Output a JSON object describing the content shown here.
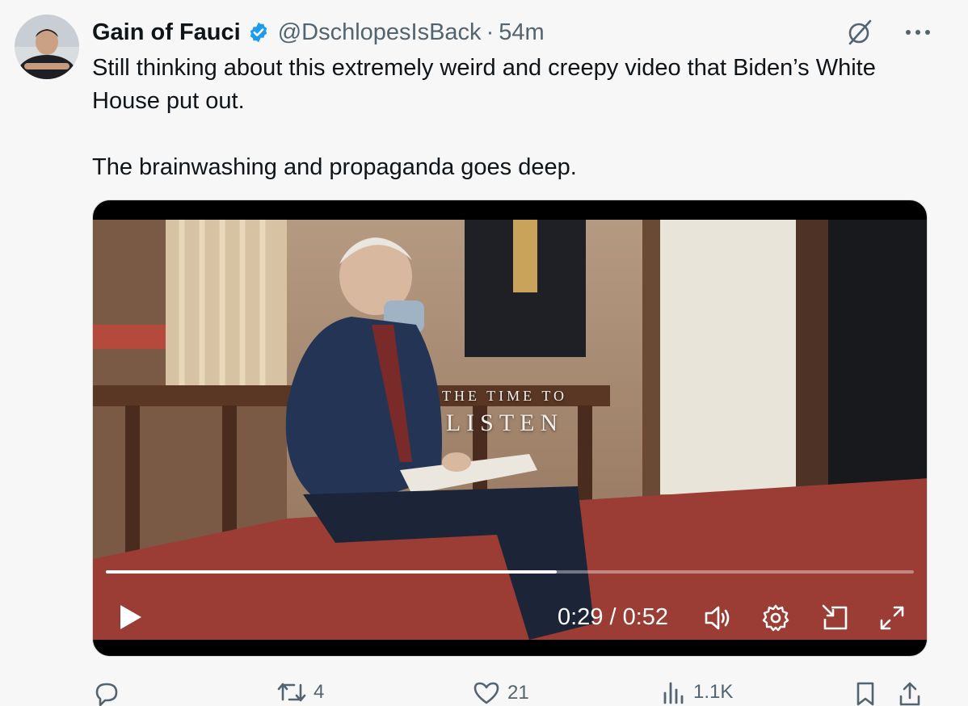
{
  "author": {
    "display_name": "Gain of Fauci",
    "handle": "@DschlopesIsBack",
    "separator": "·",
    "timestamp": "54m",
    "verified": true
  },
  "tweet": {
    "text": "Still thinking about this extremely weird and creepy video that Biden’s White House put out.\n\nThe brainwashing and propaganda goes deep."
  },
  "video": {
    "overlay_line1": "THE TIME TO",
    "overlay_line2": "LISTEN",
    "timecode": "0:29 / 0:52",
    "progress_fraction": 0.558,
    "controls": [
      "play-icon",
      "volume-icon",
      "settings-icon",
      "picture-in-picture-icon",
      "fullscreen-icon"
    ]
  },
  "actions": {
    "reply_count": "",
    "retweet_count": "4",
    "like_count": "21",
    "views_count": "1.1K"
  },
  "colors": {
    "verified_blue": "#1d9bf0",
    "secondary_text": "#536471",
    "primary_text": "#0f1419",
    "background": "#f7f7f7"
  }
}
